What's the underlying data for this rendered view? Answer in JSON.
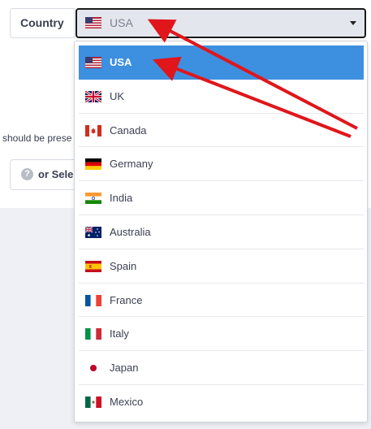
{
  "form": {
    "country_label": "Country",
    "selected_value": "USA",
    "hint_text": "should be prese",
    "or_select_label": "or Sele",
    "help_glyph": "?"
  },
  "dropdown": {
    "options": [
      {
        "label": "USA",
        "flag": "us-flag-icon",
        "selected": true
      },
      {
        "label": "UK",
        "flag": "uk-flag-icon",
        "selected": false
      },
      {
        "label": "Canada",
        "flag": "canada-flag-icon",
        "selected": false
      },
      {
        "label": "Germany",
        "flag": "germany-flag-icon",
        "selected": false
      },
      {
        "label": "India",
        "flag": "india-flag-icon",
        "selected": false
      },
      {
        "label": "Australia",
        "flag": "australia-flag-icon",
        "selected": false
      },
      {
        "label": "Spain",
        "flag": "spain-flag-icon",
        "selected": false
      },
      {
        "label": "France",
        "flag": "france-flag-icon",
        "selected": false
      },
      {
        "label": "Italy",
        "flag": "italy-flag-icon",
        "selected": false
      },
      {
        "label": "Japan",
        "flag": "japan-flag-icon",
        "selected": false
      },
      {
        "label": "Mexico",
        "flag": "mexico-flag-icon",
        "selected": false
      }
    ]
  },
  "colors": {
    "selected_bg": "#3d8fe0",
    "annotation_arrow": "#e0161b"
  }
}
